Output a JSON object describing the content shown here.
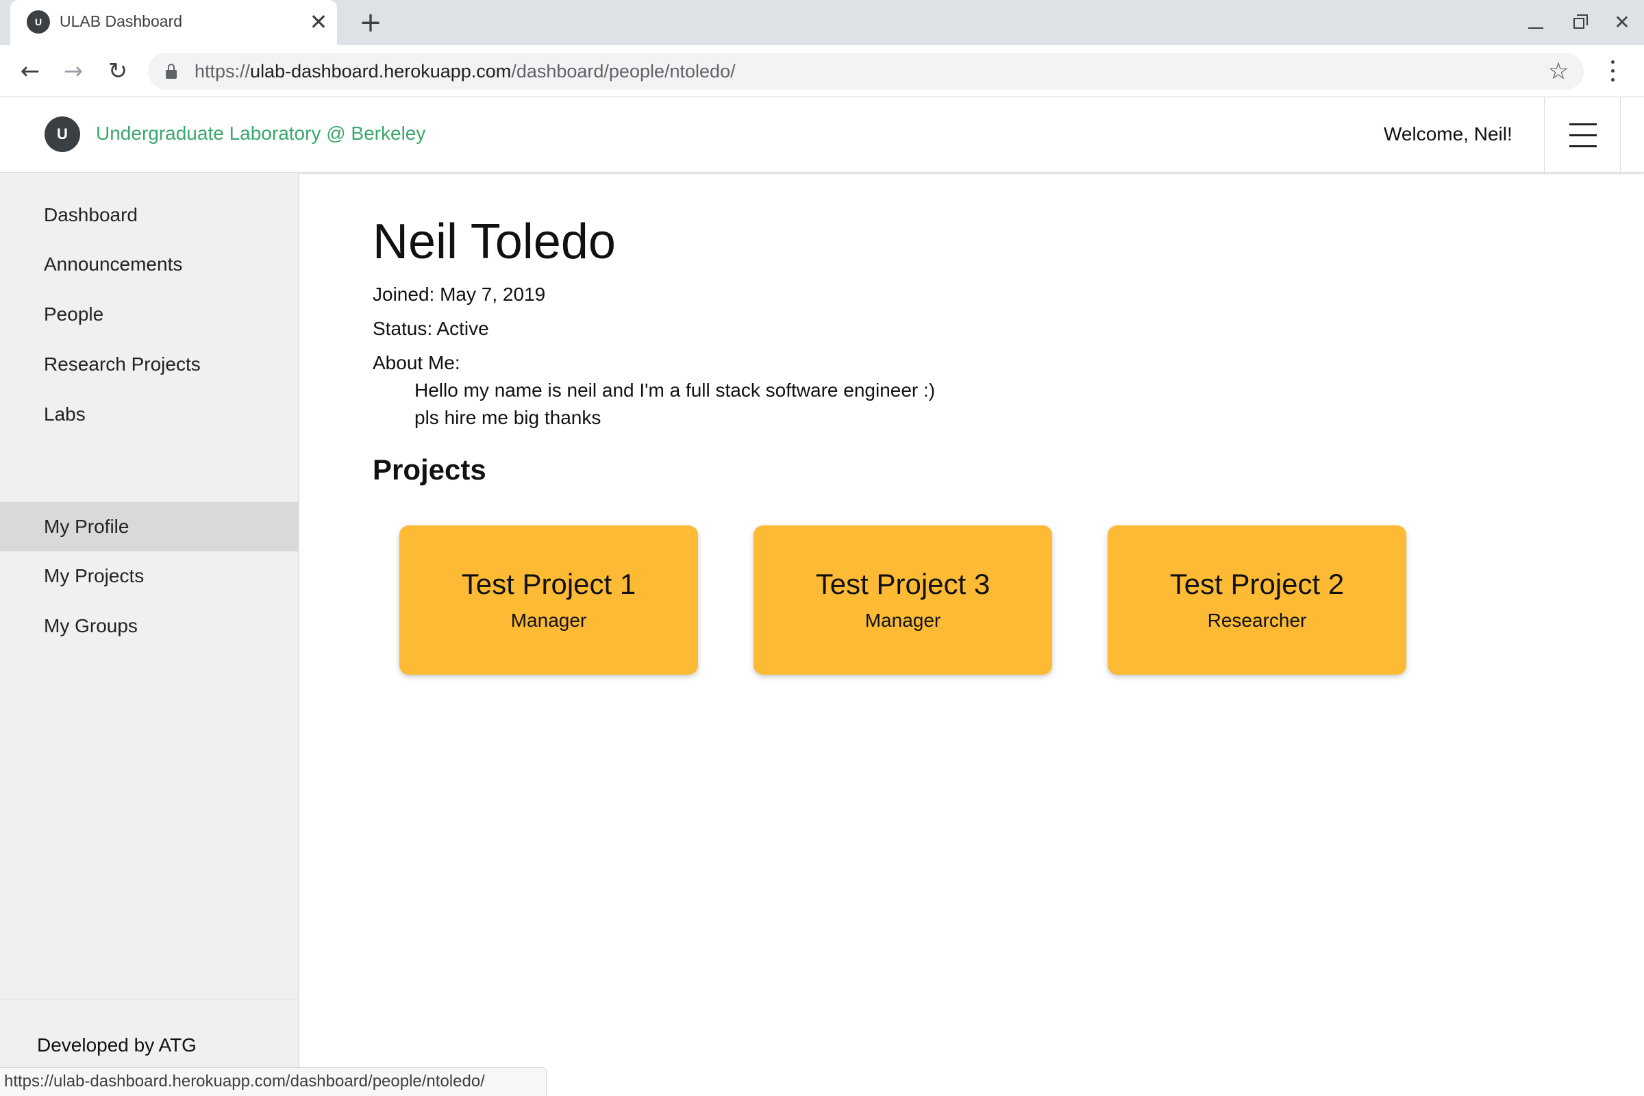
{
  "browser": {
    "tab_title": "ULAB Dashboard",
    "favicon_text": "U",
    "close_glyph": "✕",
    "new_tab_glyph": "+",
    "url_scheme": "https://",
    "url_host": "ulab-dashboard.herokuapp.com",
    "url_path": "/dashboard/people/ntoledo/",
    "back_glyph": "←",
    "forward_glyph": "→",
    "reload_glyph": "↻",
    "star_glyph": "☆",
    "win_close_glyph": "✕",
    "status_url": "https://ulab-dashboard.herokuapp.com/dashboard/people/ntoledo/"
  },
  "header": {
    "logo_text": "U",
    "site_name": "Undergraduate Laboratory @ Berkeley",
    "welcome": "Welcome, Neil!"
  },
  "sidebar": {
    "items": [
      {
        "label": "Dashboard"
      },
      {
        "label": "Announcements"
      },
      {
        "label": "People"
      },
      {
        "label": "Research Projects"
      },
      {
        "label": "Labs"
      }
    ],
    "personal_items": [
      {
        "label": "My Profile",
        "active": true
      },
      {
        "label": "My Projects"
      },
      {
        "label": "My Groups"
      }
    ],
    "footer": "Developed by ATG"
  },
  "profile": {
    "name": "Neil Toledo",
    "joined": "Joined: May 7, 2019",
    "status": "Status: Active",
    "about_label": "About Me:",
    "about_lines": [
      "Hello my name is neil and I'm a full stack software engineer :)",
      "pls hire me big thanks"
    ]
  },
  "projects": {
    "heading": "Projects",
    "cards": [
      {
        "title": "Test Project 1",
        "role": "Manager"
      },
      {
        "title": "Test Project 3",
        "role": "Manager"
      },
      {
        "title": "Test Project 2",
        "role": "Researcher"
      }
    ]
  },
  "colors": {
    "accent_green": "#3aa76d",
    "card_yellow": "#fdbb35",
    "sidebar_bg": "#f0f0f0",
    "sidebar_active": "#d9d9d9"
  }
}
